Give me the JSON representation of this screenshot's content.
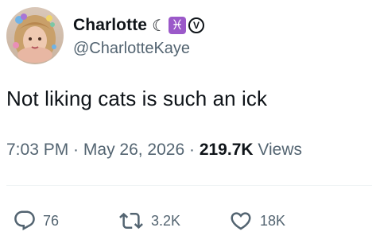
{
  "author": {
    "display_name": "Charlotte",
    "emojis": {
      "moon": "☾",
      "pisces": "♓",
      "v": "V"
    },
    "handle": "@CharlotteKaye",
    "avatar_icon": "profile-photo"
  },
  "tweet": {
    "text": "Not liking cats is such an ick"
  },
  "meta": {
    "time": "7:03 PM",
    "separator_1": " · ",
    "date": "May 26, 2026",
    "separator_2": " · ",
    "views_count": "219.7K",
    "views_label": " Views"
  },
  "actions": {
    "replies": {
      "icon": "reply-icon",
      "count": "76"
    },
    "retweets": {
      "icon": "retweet-icon",
      "count": "3.2K"
    },
    "likes": {
      "icon": "heart-icon",
      "count": "18K"
    }
  },
  "colors": {
    "text_primary": "#0f1419",
    "text_secondary": "#536471",
    "divider": "#eff3f4",
    "pisces_badge": "#9b59c9"
  }
}
